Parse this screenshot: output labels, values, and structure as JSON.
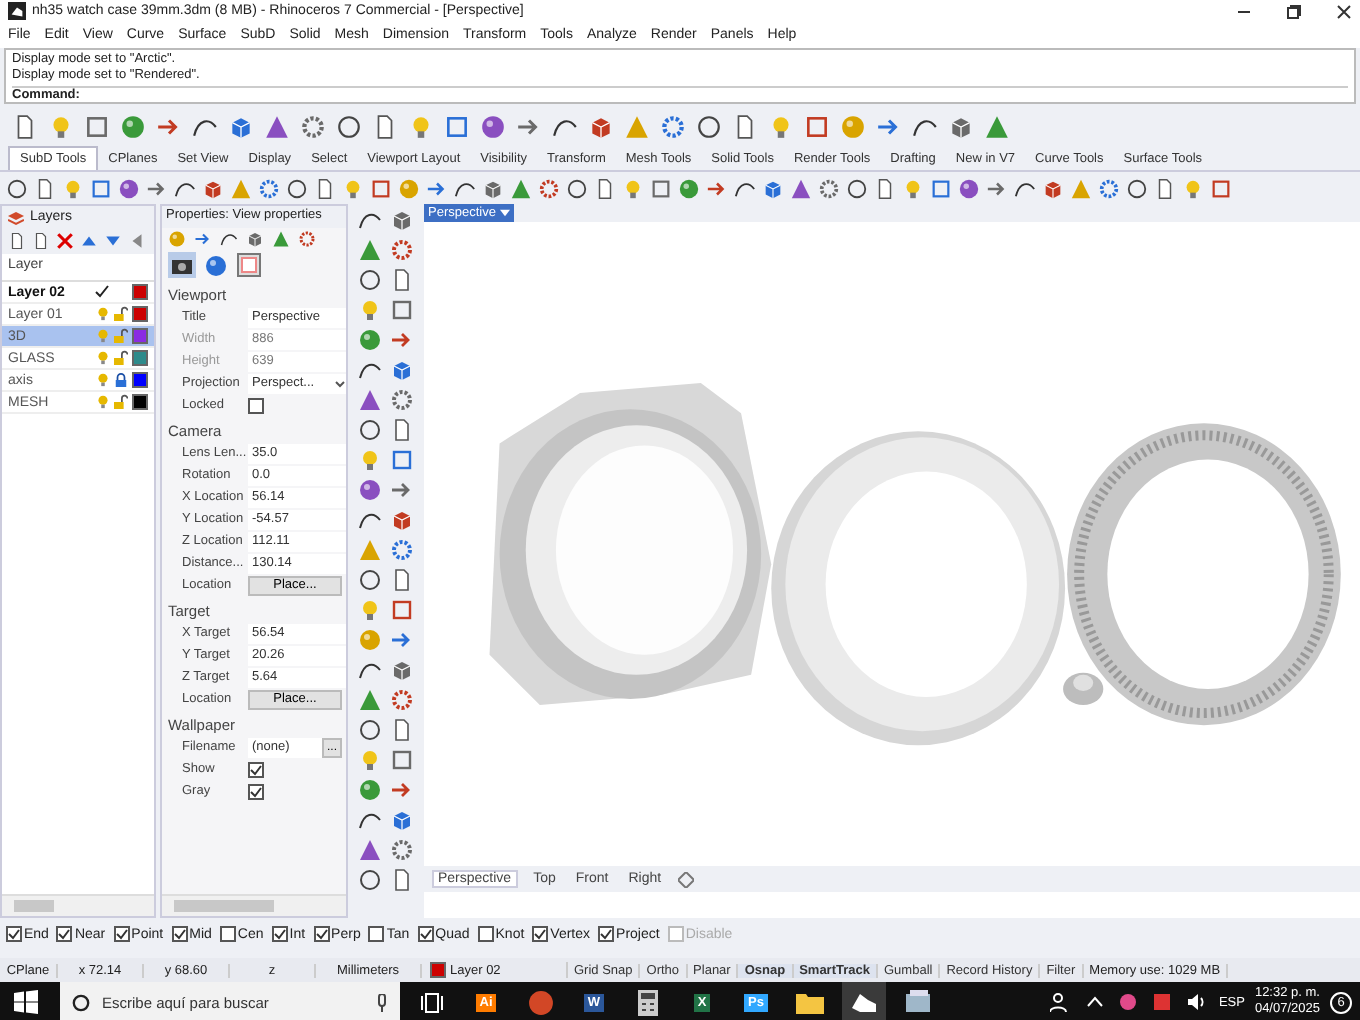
{
  "window": {
    "title": "nh35 watch case 39mm.3dm (8 MB) - Rhinoceros 7 Commercial - [Perspective]"
  },
  "menu": [
    "File",
    "Edit",
    "View",
    "Curve",
    "Surface",
    "SubD",
    "Solid",
    "Mesh",
    "Dimension",
    "Transform",
    "Tools",
    "Analyze",
    "Render",
    "Panels",
    "Help"
  ],
  "command": {
    "history": [
      "Display mode set to \"Arctic\".",
      "Display mode set to \"Rendered\"."
    ],
    "prompt": "Command:"
  },
  "toolbar_tabs": [
    {
      "label": "SubD Tools",
      "selected": true
    },
    {
      "label": "CPlanes",
      "selected": false
    },
    {
      "label": "Set View",
      "selected": false
    },
    {
      "label": "Display",
      "selected": false
    },
    {
      "label": "Select",
      "selected": false
    },
    {
      "label": "Viewport Layout",
      "selected": false
    },
    {
      "label": "Visibility",
      "selected": false
    },
    {
      "label": "Transform",
      "selected": false
    },
    {
      "label": "Mesh Tools",
      "selected": false
    },
    {
      "label": "Solid Tools",
      "selected": false
    },
    {
      "label": "Render Tools",
      "selected": false
    },
    {
      "label": "Drafting",
      "selected": false
    },
    {
      "label": "New in V7",
      "selected": false
    },
    {
      "label": "Curve Tools",
      "selected": false
    },
    {
      "label": "Surface Tools",
      "selected": false
    }
  ],
  "layers": {
    "title": "Layers",
    "header": "Layer",
    "rows": [
      {
        "name": "Layer 02",
        "current": true,
        "selected": false,
        "color": "#cc0000"
      },
      {
        "name": "Layer 01",
        "current": false,
        "selected": false,
        "locked": false,
        "color": "#cc0000"
      },
      {
        "name": "3D",
        "current": false,
        "selected": true,
        "locked": false,
        "color": "#8a2be2"
      },
      {
        "name": "GLASS",
        "current": false,
        "selected": false,
        "locked": false,
        "color": "#2e8b8b"
      },
      {
        "name": "axis",
        "current": false,
        "selected": false,
        "locked": true,
        "color": "#0000ff"
      },
      {
        "name": "MESH",
        "current": false,
        "selected": false,
        "locked": false,
        "color": "#000000"
      }
    ]
  },
  "properties": {
    "title": "Properties: View properties",
    "sections": [
      {
        "title": "Viewport",
        "rows": [
          {
            "label": "Title",
            "kind": "field",
            "value": "Perspective"
          },
          {
            "label": "Width",
            "kind": "readonly",
            "value": "886"
          },
          {
            "label": "Height",
            "kind": "readonly",
            "value": "639"
          },
          {
            "label": "Projection",
            "kind": "dropdown",
            "value": "Perspect..."
          },
          {
            "label": "Locked",
            "kind": "checkbox",
            "checked": false
          }
        ]
      },
      {
        "title": "Camera",
        "rows": [
          {
            "label": "Lens Len...",
            "kind": "field",
            "value": "35.0"
          },
          {
            "label": "Rotation",
            "kind": "field",
            "value": "0.0"
          },
          {
            "label": "X Location",
            "kind": "field",
            "value": "56.14"
          },
          {
            "label": "Y Location",
            "kind": "field",
            "value": "-54.57"
          },
          {
            "label": "Z Location",
            "kind": "field",
            "value": "112.11"
          },
          {
            "label": "Distance...",
            "kind": "field",
            "value": "130.14"
          },
          {
            "label": "Location",
            "kind": "button",
            "value": "Place..."
          }
        ]
      },
      {
        "title": "Target",
        "rows": [
          {
            "label": "X Target",
            "kind": "field",
            "value": "56.54"
          },
          {
            "label": "Y Target",
            "kind": "field",
            "value": "20.26"
          },
          {
            "label": "Z Target",
            "kind": "field",
            "value": "5.64"
          },
          {
            "label": "Location",
            "kind": "button",
            "value": "Place..."
          }
        ]
      },
      {
        "title": "Wallpaper",
        "rows": [
          {
            "label": "Filename",
            "kind": "file",
            "value": "(none)",
            "button": "..."
          },
          {
            "label": "Show",
            "kind": "checkbox",
            "checked": true
          },
          {
            "label": "Gray",
            "kind": "checkbox",
            "checked": true
          }
        ]
      }
    ]
  },
  "viewport": {
    "title": "Perspective",
    "tabs": [
      {
        "label": "Perspective",
        "selected": true
      },
      {
        "label": "Top",
        "selected": false
      },
      {
        "label": "Front",
        "selected": false
      },
      {
        "label": "Right",
        "selected": false
      }
    ]
  },
  "osnaps": [
    {
      "label": "End",
      "checked": true,
      "disabled": false
    },
    {
      "label": "Near",
      "checked": true,
      "disabled": false
    },
    {
      "label": "Point",
      "checked": true,
      "disabled": false
    },
    {
      "label": "Mid",
      "checked": true,
      "disabled": false
    },
    {
      "label": "Cen",
      "checked": false,
      "disabled": false
    },
    {
      "label": "Int",
      "checked": true,
      "disabled": false
    },
    {
      "label": "Perp",
      "checked": true,
      "disabled": false
    },
    {
      "label": "Tan",
      "checked": false,
      "disabled": false
    },
    {
      "label": "Quad",
      "checked": true,
      "disabled": false
    },
    {
      "label": "Knot",
      "checked": false,
      "disabled": false
    },
    {
      "label": "Vertex",
      "checked": true,
      "disabled": false
    },
    {
      "label": "Project",
      "checked": true,
      "disabled": false
    },
    {
      "label": "Disable",
      "checked": false,
      "disabled": true
    }
  ],
  "status_bar": {
    "cplane": "CPlane",
    "x": "x 72.14",
    "y": "y 68.60",
    "z": "z",
    "units": "Millimeters",
    "layer": {
      "name": "Layer 02",
      "color": "#cc0000"
    },
    "toggles": [
      {
        "label": "Grid Snap",
        "on": false
      },
      {
        "label": "Ortho",
        "on": false
      },
      {
        "label": "Planar",
        "on": false
      },
      {
        "label": "Osnap",
        "on": true
      },
      {
        "label": "SmartTrack",
        "on": true
      },
      {
        "label": "Gumball",
        "on": false
      },
      {
        "label": "Record History",
        "on": false
      },
      {
        "label": "Filter",
        "on": false
      }
    ],
    "memory": "Memory use: 1029 MB"
  },
  "taskbar": {
    "search_placeholder": "Escribe aquí para buscar",
    "apps": [
      {
        "kind": "taskview"
      },
      {
        "kind": "letter",
        "label": "Ai",
        "color": "#ff7c00"
      },
      {
        "kind": "round",
        "color": "#d24726"
      },
      {
        "kind": "letter",
        "label": "W",
        "color": "#2b579a"
      },
      {
        "kind": "calc",
        "color": "#cccccc"
      },
      {
        "kind": "letter",
        "label": "X",
        "color": "#217346"
      },
      {
        "kind": "letter",
        "label": "Ps",
        "color": "#31a8ff"
      },
      {
        "kind": "folder",
        "color": "#f4c542"
      },
      {
        "kind": "rhino",
        "color": "#ffffff"
      },
      {
        "kind": "window",
        "color": "#9fb7c9"
      }
    ],
    "language": "ESP",
    "time": "12:32 p. m.",
    "date": "04/07/2025",
    "notifications": "6"
  }
}
